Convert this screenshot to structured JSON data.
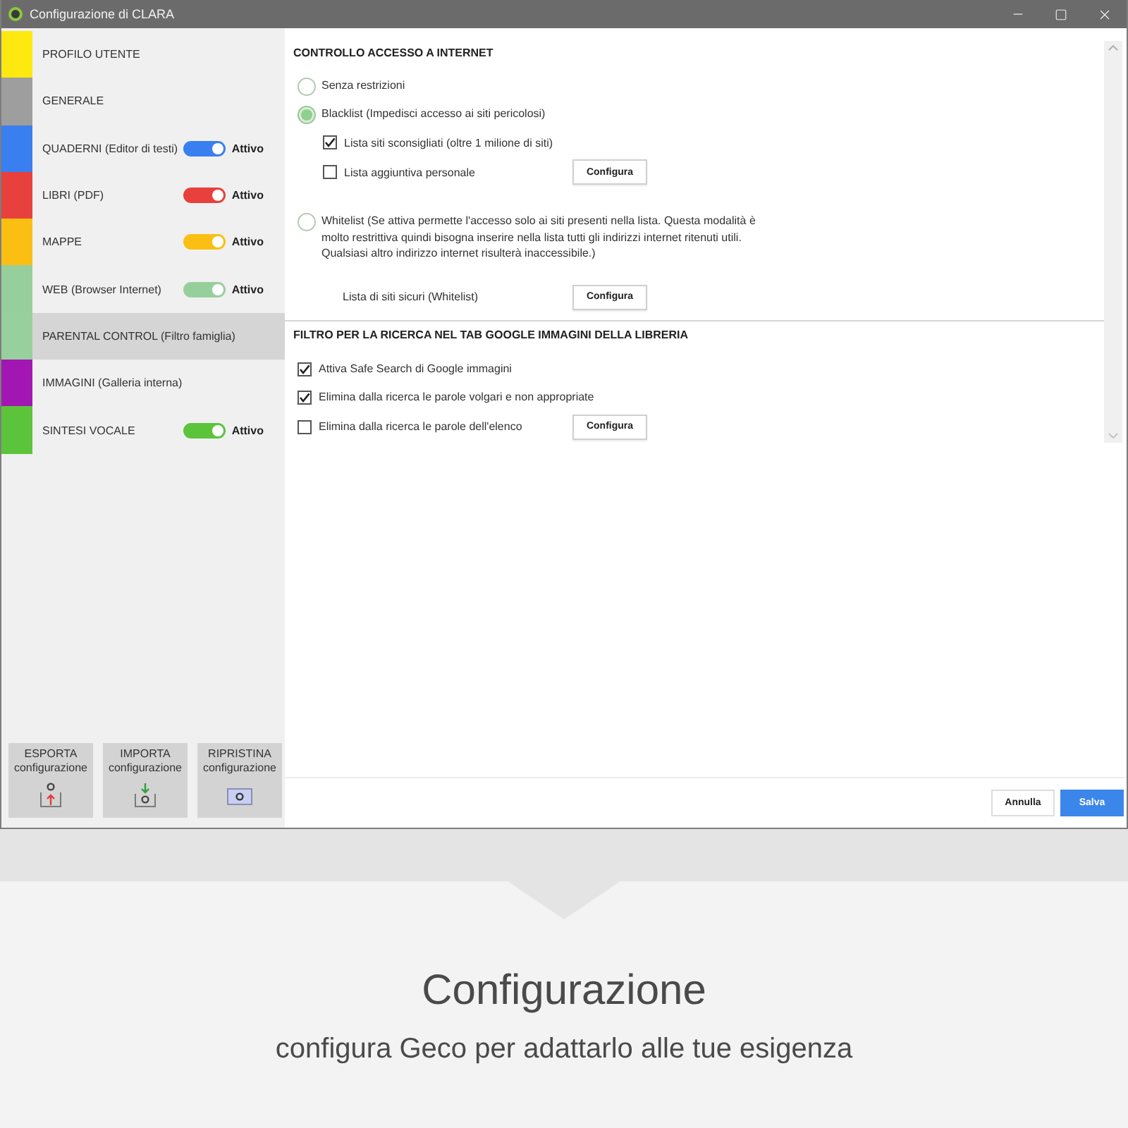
{
  "window": {
    "title": "Configurazione di CLARA"
  },
  "sidebar": {
    "items": [
      {
        "label": "PROFILO UTENTE",
        "color": "#fde910",
        "selected": false
      },
      {
        "label": "GENERALE",
        "color": "#9e9e9e",
        "selected": false
      },
      {
        "label": "QUADERNI (Editor di testi)",
        "color": "#3a7ff0",
        "selected": false,
        "toggle": {
          "on": true,
          "label": "Attivo"
        }
      },
      {
        "label": "LIBRI (PDF)",
        "color": "#e8403c",
        "selected": false,
        "toggle": {
          "on": true,
          "label": "Attivo"
        }
      },
      {
        "label": "MAPPE",
        "color": "#fbbf14",
        "selected": false,
        "toggle": {
          "on": true,
          "label": "Attivo"
        }
      },
      {
        "label": "WEB (Browser Internet)",
        "color": "#97cf9c",
        "selected": false,
        "toggle": {
          "on": true,
          "label": "Attivo"
        }
      },
      {
        "label": "PARENTAL CONTROL (Filtro famiglia)",
        "color": "#98d09d",
        "selected": true
      },
      {
        "label": "IMMAGINI (Galleria interna)",
        "color": "#a216b4",
        "selected": false
      },
      {
        "label": "SINTESI VOCALE",
        "color": "#5cc43a",
        "selected": false,
        "toggle": {
          "on": true,
          "label": "Attivo"
        }
      }
    ],
    "actions": [
      {
        "kind": "export",
        "lines": [
          "ESPORTA",
          "configurazione"
        ]
      },
      {
        "kind": "import",
        "lines": [
          "IMPORTA",
          "configurazione"
        ]
      },
      {
        "kind": "reset",
        "lines": [
          "RIPRISTINA",
          "configurazione"
        ]
      }
    ]
  },
  "sections": [
    {
      "title": "CONTROLLO ACCESSO A INTERNET",
      "options": [
        {
          "kind": "radio",
          "label": "Senza restrizioni",
          "selected": false
        },
        {
          "kind": "radio",
          "label": "Blacklist (Impedisci accesso ai siti pericolosi)",
          "selected": true,
          "children": [
            {
              "kind": "checkbox",
              "label": "Lista siti sconsigliati (oltre 1 milione di siti)",
              "checked": true
            },
            {
              "kind": "checkbox",
              "label": "Lista aggiuntiva personale",
              "checked": false,
              "button": "Configura"
            }
          ]
        },
        {
          "kind": "radio",
          "label": "Whitelist (Se attiva permette l'accesso solo ai siti presenti nella lista. Questa modalità è molto restrittiva quindi bisogna inserire nella lista tutti gli indirizzi internet ritenuti utili. Qualsiasi altro indirizzo internet risulterà inaccessibile.)",
          "selected": false,
          "children": [
            {
              "kind": "text",
              "label": "Lista di siti sicuri (Whitelist)",
              "button": "Configura"
            }
          ]
        }
      ]
    },
    {
      "title": "FILTRO PER LA RICERCA NEL TAB GOOGLE IMMAGINI DELLA LIBRERIA",
      "options": [
        {
          "kind": "checkbox",
          "label": "Attiva Safe Search di Google immagini",
          "checked": true
        },
        {
          "kind": "checkbox",
          "label": "Elimina dalla ricerca le parole volgari e non appropriate",
          "checked": true
        },
        {
          "kind": "checkbox",
          "label": "Elimina dalla ricerca le parole dell'elenco",
          "checked": false,
          "button": "Configura"
        }
      ]
    }
  ],
  "footer": {
    "buttons": [
      {
        "kind": "secondary",
        "label": "Annulla"
      },
      {
        "kind": "primary",
        "label": "Salva"
      }
    ]
  },
  "caption": {
    "title": "Configurazione",
    "subtitle": "configura Geco per adattarlo alle tue esigenza"
  }
}
